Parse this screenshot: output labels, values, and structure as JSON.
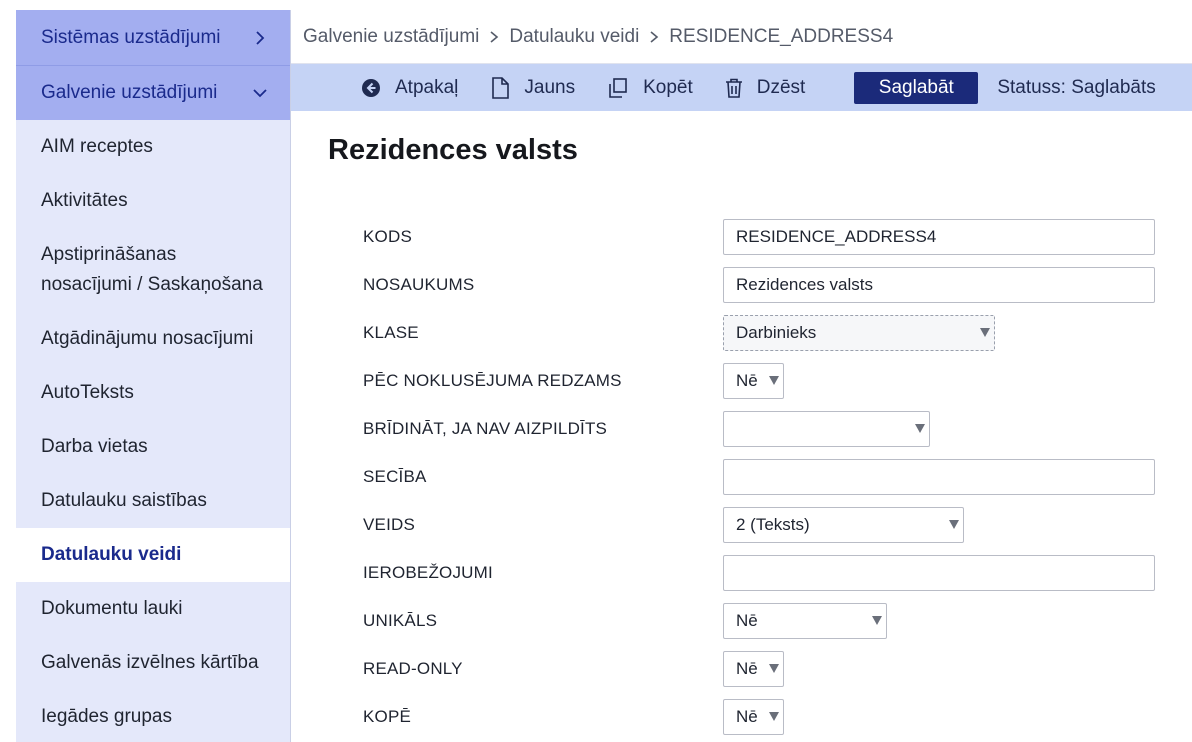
{
  "sidebar": {
    "sections": [
      {
        "label": "Sistēmas uzstādījumi"
      },
      {
        "label": "Galvenie uzstādījumi"
      }
    ],
    "items": [
      {
        "label": "AIM receptes"
      },
      {
        "label": "Aktivitātes"
      },
      {
        "label": "Apstiprināšanas nosacījumi / Saskaņošana"
      },
      {
        "label": "Atgādinājumu nosacījumi"
      },
      {
        "label": "AutoTeksts"
      },
      {
        "label": "Darba vietas"
      },
      {
        "label": "Datulauku saistības"
      },
      {
        "label": "Datulauku veidi"
      },
      {
        "label": "Dokumentu lauki"
      },
      {
        "label": "Galvenās izvēlnes kārtība"
      },
      {
        "label": "Iegādes grupas"
      }
    ]
  },
  "breadcrumb": [
    "Galvenie uzstādījumi",
    "Datulauku veidi",
    "RESIDENCE_ADDRESS4"
  ],
  "toolbar": {
    "back_label": "Atpakaļ",
    "new_label": "Jauns",
    "copy_label": "Kopēt",
    "delete_label": "Dzēst",
    "save_label": "Saglabāt",
    "status_label": "Statuss: Saglabāts"
  },
  "form": {
    "title": "Rezidences valsts",
    "fields": [
      {
        "label": "KODS",
        "value": ""
      },
      {
        "label": "NOSAUKUMS",
        "value": ""
      },
      {
        "label": "KLASE",
        "value": "Darbinieks"
      },
      {
        "label": "PĒC NOKLUSĒJUMA REDZAMS",
        "value": "Nē"
      },
      {
        "label": "BRĪDINĀT, JA NAV AIZPILDĪTS",
        "value": ""
      },
      {
        "label": "SECĪBA",
        "value": ""
      },
      {
        "label": "VEIDS",
        "value": "2 (Teksts)"
      },
      {
        "label": "IEROBEŽOJUMI",
        "value": ""
      },
      {
        "label": "UNIKĀLS",
        "value": "Nē"
      },
      {
        "label": "READ-ONLY",
        "value": "Nē"
      },
      {
        "label": "KOPĒ",
        "value": "Nē"
      }
    ],
    "kods_value": "RESIDENCE_ADDRESS4",
    "nosaukums_value": "Rezidences valsts"
  },
  "colors": {
    "accent": "#1b2a7a",
    "sidebar_bg": "#e4e8fa",
    "toolbar_bg": "#c5d3f5",
    "section_bg": "#a3aef0"
  }
}
